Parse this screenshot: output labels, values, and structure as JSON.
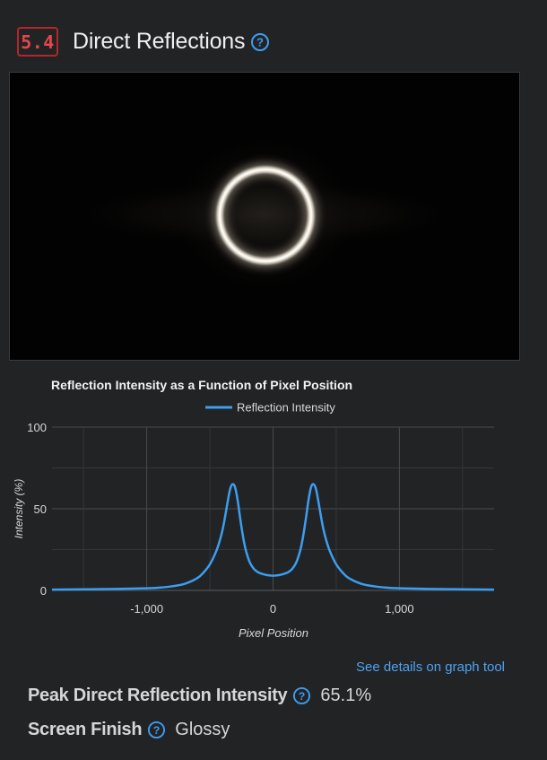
{
  "section": {
    "score": "5.4",
    "title": "Direct Reflections",
    "help_icon": "question-circle-icon",
    "accent_color": "#e4474c"
  },
  "photo": {
    "subject": "circular-ring-light-reflection"
  },
  "chart_data": {
    "type": "line",
    "title": "Reflection Intensity as a Function of Pixel Position",
    "xlabel": "Pixel Position",
    "ylabel": "Intensity (%)",
    "xlim": [
      -1750,
      1750
    ],
    "ylim": [
      0,
      100
    ],
    "x_ticks": [
      -1000,
      0,
      1000
    ],
    "x_tick_labels": [
      "-1,000",
      "0",
      "1,000"
    ],
    "y_ticks": [
      0,
      50,
      100
    ],
    "y_tick_labels": [
      "0",
      "50",
      "100"
    ],
    "grid": true,
    "legend": "top-center",
    "series": [
      {
        "name": "Reflection Intensity",
        "color": "#3c9ef0",
        "x": [
          -1750,
          -1500,
          -1250,
          -1000,
          -900,
          -800,
          -700,
          -600,
          -550,
          -500,
          -450,
          -420,
          -400,
          -380,
          -360,
          -340,
          -320,
          -300,
          -280,
          -260,
          -240,
          -220,
          -200,
          -180,
          -150,
          -120,
          -100,
          -80,
          -50,
          -20,
          0,
          20,
          50,
          80,
          100,
          120,
          150,
          180,
          200,
          220,
          240,
          260,
          280,
          300,
          320,
          340,
          360,
          380,
          400,
          420,
          450,
          500,
          550,
          600,
          700,
          800,
          900,
          1000,
          1250,
          1500,
          1750
        ],
        "y": [
          0.5,
          0.7,
          0.9,
          1.3,
          1.7,
          2.5,
          4.0,
          7.5,
          11,
          16,
          24,
          31,
          37,
          45,
          54,
          62,
          65.1,
          63,
          55,
          44,
          34,
          26,
          20.5,
          16.5,
          13,
          11.2,
          10.5,
          10,
          9.4,
          9.1,
          9,
          9.1,
          9.4,
          10,
          10.5,
          11.2,
          13,
          16.5,
          20.5,
          26,
          34,
          44,
          55,
          63,
          65.1,
          62,
          54,
          45,
          37,
          31,
          24,
          16,
          11,
          7.5,
          4.0,
          2.5,
          1.7,
          1.3,
          0.9,
          0.7,
          0.5
        ]
      }
    ]
  },
  "details_link": "See details on graph tool",
  "specs": [
    {
      "label": "Peak Direct Reflection Intensity",
      "value": "65.1%"
    },
    {
      "label": "Screen Finish",
      "value": "Glossy"
    }
  ]
}
